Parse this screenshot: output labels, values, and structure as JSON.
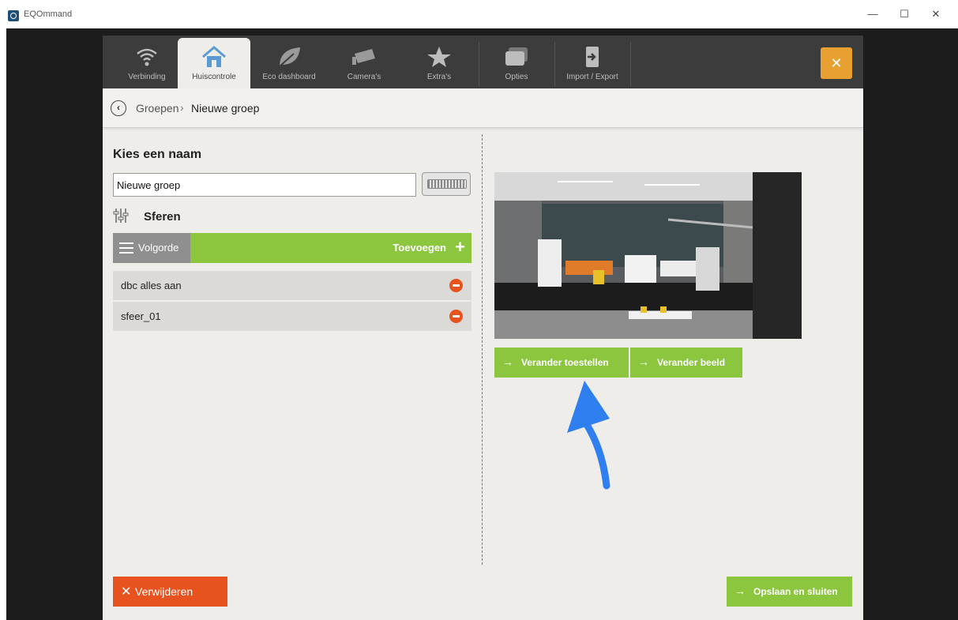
{
  "window": {
    "title": "EQOmmand",
    "minimize": "—",
    "maximize": "☐",
    "close": "✕"
  },
  "tabs": [
    {
      "label": "Verbinding",
      "icon": "wifi-icon"
    },
    {
      "label": "Huiscontrole",
      "icon": "house-icon",
      "active": true
    },
    {
      "label": "Eco dashboard",
      "icon": "leaf-icon"
    },
    {
      "label": "Camera's",
      "icon": "camera-icon"
    },
    {
      "label": "Extra's",
      "icon": "star-icon"
    },
    {
      "label": "Opties",
      "icon": "options-icon"
    },
    {
      "label": "Import / Export",
      "icon": "import-export-icon"
    }
  ],
  "close_app": "✕",
  "breadcrumb": {
    "back": "‹",
    "parent": "Groepen",
    "separator": "›",
    "current": "Nieuwe groep"
  },
  "name_section": {
    "heading": "Kies een naam",
    "value": "Nieuwe groep"
  },
  "sferen": {
    "heading": "Sferen",
    "order_label": "Volgorde",
    "add_label": "Toevoegen",
    "add_symbol": "+",
    "items": [
      {
        "label": "dbc alles aan"
      },
      {
        "label": "sfeer_01"
      }
    ]
  },
  "image_actions": {
    "arrow": "→",
    "change_devices": "Verander toestellen",
    "change_image": "Verander beeld"
  },
  "footer": {
    "delete_symbol": "✕",
    "delete_label": "Verwijderen",
    "save_arrow": "→",
    "save_label": "Opslaan en sluiten"
  },
  "colors": {
    "green": "#8cc63f",
    "orange": "#e8521e",
    "amber": "#e8a030",
    "annotation": "#2f7ff0"
  }
}
